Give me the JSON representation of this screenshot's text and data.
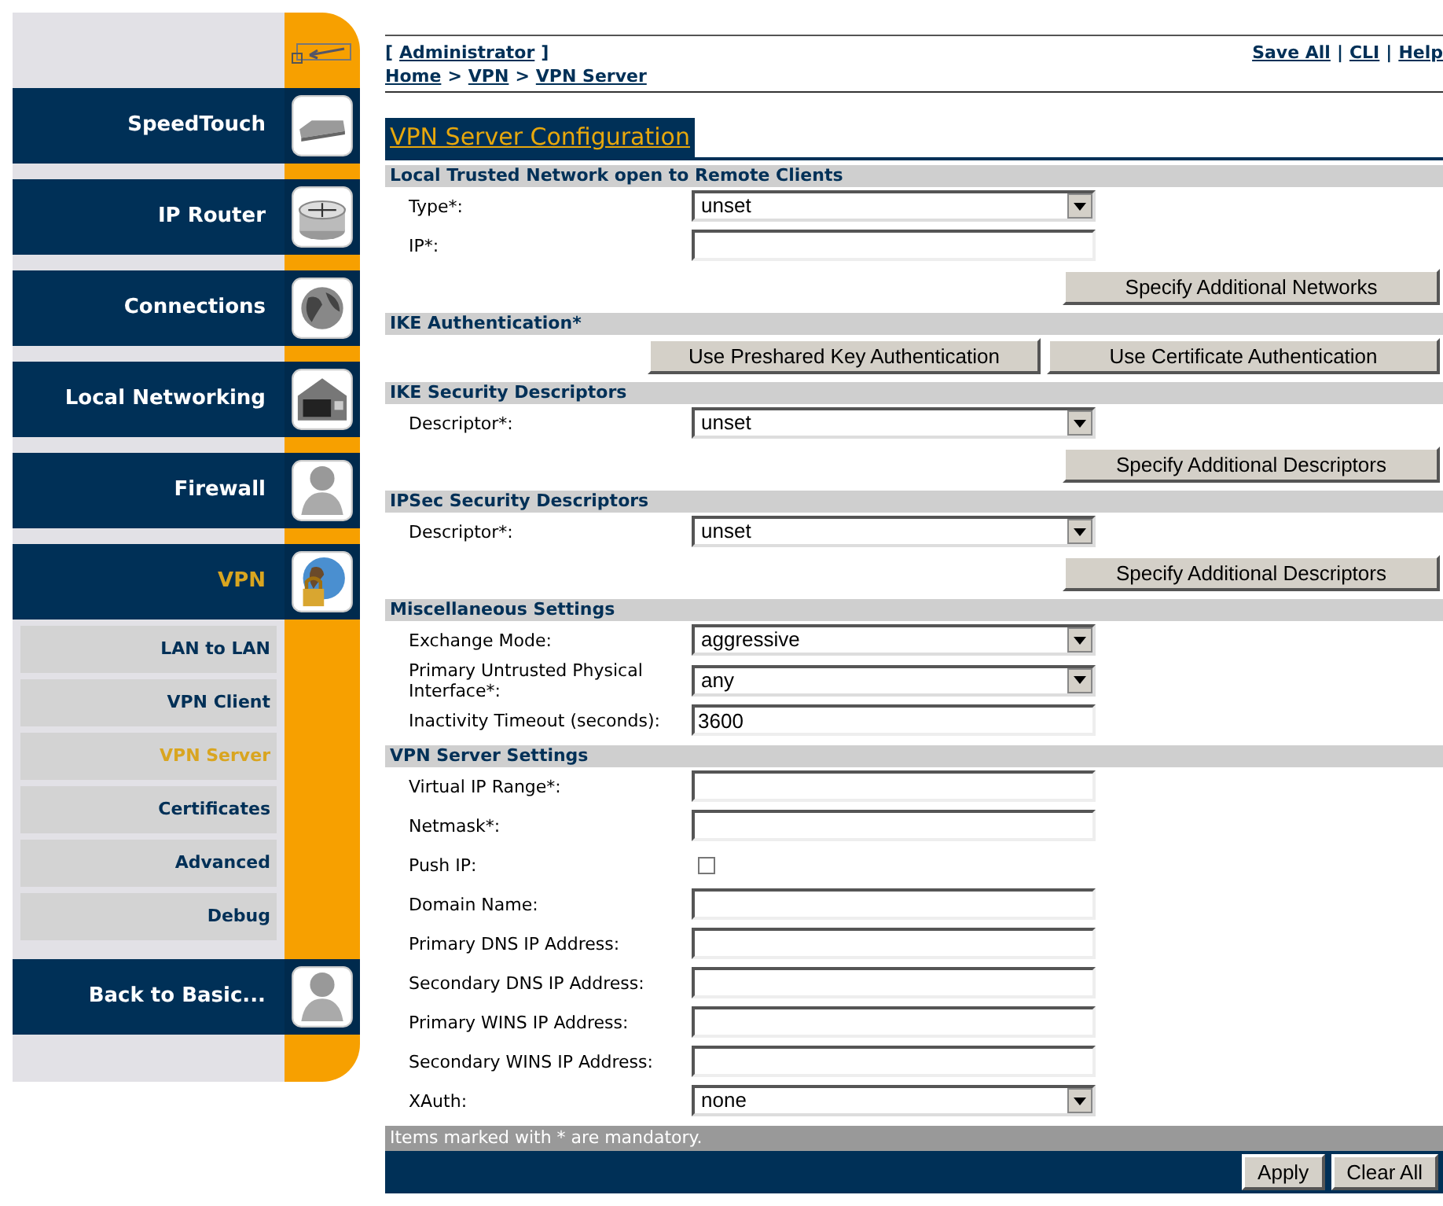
{
  "header": {
    "open_bracket": "[",
    "user_link": "Administrator",
    "close_bracket": "]",
    "breadcrumb": [
      "Home",
      "VPN",
      "VPN Server"
    ],
    "breadcrumb_separator": ">",
    "actions": [
      "Save All",
      "CLI",
      "Help"
    ],
    "action_separator": "|"
  },
  "sidebar": {
    "items": [
      {
        "label": "SpeedTouch",
        "selected": false
      },
      {
        "label": "IP Router",
        "selected": false
      },
      {
        "label": "Connections",
        "selected": false
      },
      {
        "label": "Local Networking",
        "selected": false
      },
      {
        "label": "Firewall",
        "selected": false
      },
      {
        "label": "VPN",
        "selected": true
      }
    ],
    "subitems": [
      {
        "label": "LAN to LAN",
        "selected": false
      },
      {
        "label": "VPN Client",
        "selected": false
      },
      {
        "label": "VPN Server",
        "selected": true
      },
      {
        "label": "Certificates",
        "selected": false
      },
      {
        "label": "Advanced",
        "selected": false
      },
      {
        "label": "Debug",
        "selected": false
      }
    ],
    "back": {
      "label": "Back to Basic..."
    }
  },
  "page_title": "VPN Server Configuration",
  "sections": [
    {
      "title": "Local Trusted Network open to Remote Clients",
      "rows": [
        {
          "kind": "select",
          "label": "Type*:",
          "value": "unset"
        },
        {
          "kind": "text",
          "label": "IP*:"
        },
        {
          "kind": "buttons",
          "buttons": [
            "Specify Additional Networks"
          ]
        }
      ]
    },
    {
      "title": "IKE Authentication*",
      "rows": [
        {
          "kind": "buttons",
          "buttons": [
            "Use Preshared Key Authentication",
            "Use Certificate Authentication"
          ]
        }
      ]
    },
    {
      "title": "IKE Security Descriptors",
      "rows": [
        {
          "kind": "select",
          "label": "Descriptor*:",
          "value": "unset"
        },
        {
          "kind": "buttons",
          "buttons": [
            "Specify Additional Descriptors"
          ]
        }
      ]
    },
    {
      "title": "IPSec Security Descriptors",
      "rows": [
        {
          "kind": "select",
          "label": "Descriptor*:",
          "value": "unset"
        },
        {
          "kind": "buttons",
          "buttons": [
            "Specify Additional Descriptors"
          ]
        }
      ]
    },
    {
      "title": "Miscellaneous Settings",
      "rows": [
        {
          "kind": "select",
          "label": "Exchange Mode:",
          "value": "aggressive"
        },
        {
          "kind": "select",
          "label": "Primary Untrusted Physical Interface*:",
          "value": "any"
        },
        {
          "kind": "text",
          "label": "Inactivity Timeout (seconds):",
          "value": "3600"
        }
      ]
    },
    {
      "title": "VPN Server Settings",
      "rows": [
        {
          "kind": "text",
          "label": "Virtual IP Range*:"
        },
        {
          "kind": "text",
          "label": "Netmask*:"
        },
        {
          "kind": "checkbox",
          "label": "Push IP:",
          "checked": false
        },
        {
          "kind": "text",
          "label": "Domain Name:"
        },
        {
          "kind": "text",
          "label": "Primary DNS IP Address:"
        },
        {
          "kind": "text",
          "label": "Secondary DNS IP Address:"
        },
        {
          "kind": "text",
          "label": "Primary WINS IP Address:"
        },
        {
          "kind": "text",
          "label": "Secondary WINS IP Address:"
        },
        {
          "kind": "select",
          "label": "XAuth:",
          "value": "none"
        }
      ]
    }
  ],
  "footer_note": "Items marked with * are mandatory.",
  "footer_buttons": [
    "Apply",
    "Clear All"
  ]
}
